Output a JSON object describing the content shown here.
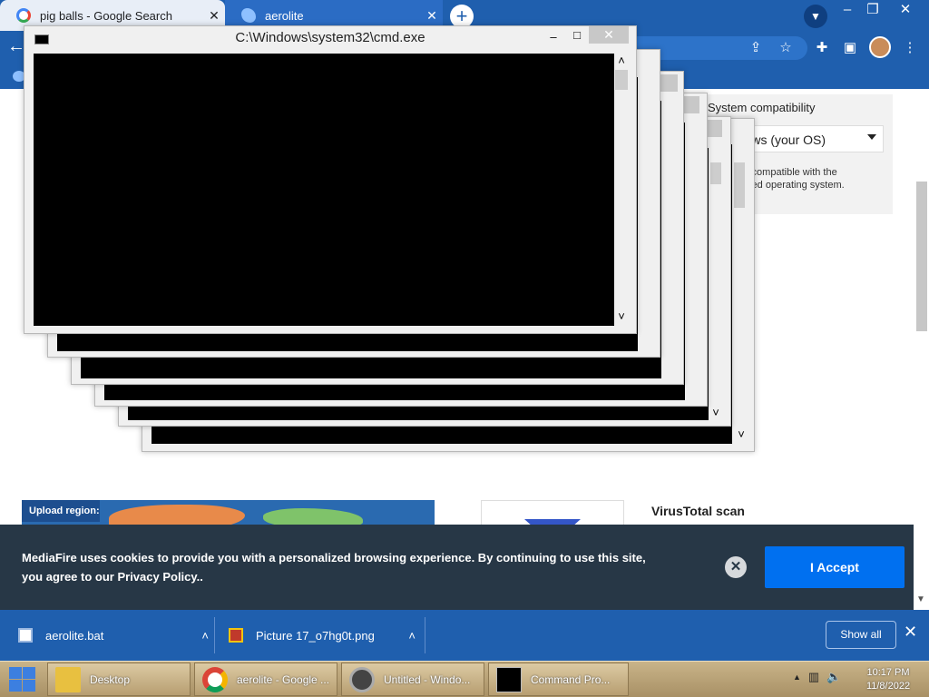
{
  "browser": {
    "tabs": [
      {
        "title": "pig balls - Google Search",
        "close": "✕"
      },
      {
        "title": "aerolite",
        "close": "✕"
      }
    ],
    "new_tab": "+",
    "window_controls": {
      "minimize": "–",
      "maximize": "❐",
      "close": "✕"
    }
  },
  "page": {
    "compat_title": "System compatibility",
    "os_select_value": "ndows (your OS)",
    "compat_text": "s compatible with the\ncted operating system.",
    "upload_region_label": "Upload region:",
    "virustotal_title": "VirusTotal scan"
  },
  "cookie_banner": {
    "text": "MediaFire uses cookies to provide you with a personalized browsing experience. By continuing to use this site, you agree to our Privacy Policy..",
    "close": "✕",
    "accept_label": "I Accept"
  },
  "cmd": {
    "title": "C:\\Windows\\system32\\cmd.exe",
    "min": "–",
    "max": "□",
    "close": "✕",
    "scroll_up": "˄",
    "scroll_down": "˅"
  },
  "downloads": {
    "items": [
      {
        "name": "aerolite.bat"
      },
      {
        "name": "Picture 17_o7hg0t.png"
      }
    ],
    "chevron": "˄",
    "show_all": "Show all",
    "close": "✕"
  },
  "taskbar": {
    "items": [
      {
        "label": "Desktop"
      },
      {
        "label": "aerolite - Google ..."
      },
      {
        "label": "Untitled - Windo..."
      },
      {
        "label": "Command Pro..."
      }
    ],
    "tray_up": "▲",
    "time": "10:17 PM",
    "date": "11/8/2022"
  },
  "colors": {
    "chrome_blue": "#1f5fae",
    "banner_bg": "#273746",
    "accept_blue": "#0070f0"
  }
}
